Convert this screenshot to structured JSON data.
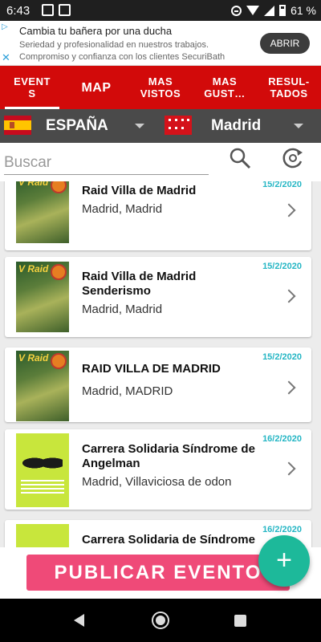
{
  "status_bar": {
    "time": "6:43",
    "battery": "61 %"
  },
  "ad": {
    "title": "Cambia tu bañera por una ducha",
    "line1": "Seriedad y profesionalidad en nuestros trabajos.",
    "line2": "Compromiso y confianza con los clientes SecuriBath",
    "button": "ABRIR"
  },
  "tabs": [
    {
      "label": "EVENT\nS",
      "active": true
    },
    {
      "label": "MAP"
    },
    {
      "label": "MAS\nVISTOS"
    },
    {
      "label": "MAS\nGUST…"
    },
    {
      "label": "RESUL-\nTADOS"
    }
  ],
  "location": {
    "country": "ESPAÑA",
    "region": "Madrid"
  },
  "search": {
    "placeholder": "Buscar"
  },
  "events": [
    {
      "title": "Raid Villa de Madrid",
      "place": "Madrid, Madrid",
      "date": "15/2/2020",
      "poster": "raid"
    },
    {
      "title": "Raid Villa de Madrid Senderismo",
      "place": "Madrid, Madrid",
      "date": "15/2/2020",
      "poster": "raid"
    },
    {
      "title": "RAID VILLA DE MADRID",
      "place": "Madrid, MADRID",
      "date": "15/2/2020",
      "poster": "raid"
    },
    {
      "title": "Carrera Solidaria Síndrome de Angelman",
      "place": "Madrid, Villaviciosa de odon",
      "date": "16/2/2020",
      "poster": "sol"
    },
    {
      "title": "Carrera Solidaria de Síndrome",
      "place": "",
      "date": "16/2/2020",
      "poster": "sol"
    }
  ],
  "publish_button": "PUBLICAR EVENTO",
  "fab_label": "+",
  "colors": {
    "tab_bar": "#d20a0a",
    "date": "#25b6c4",
    "publish": "#ef4a78",
    "fab": "#1db99a"
  }
}
